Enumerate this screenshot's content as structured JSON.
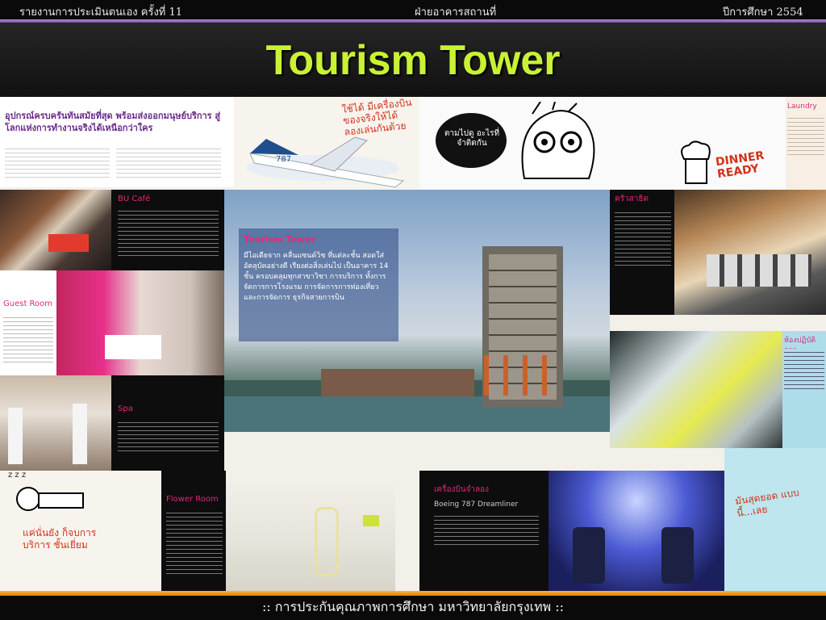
{
  "header": {
    "left_text": "รายงานการประเมินตนเอง ครั้งที่ 11",
    "center_text": "ฝ่ายอาคารสถานที่",
    "right_text": "ปีการศึกษา 2554"
  },
  "title": "Tourism Tower",
  "collage": {
    "intro_heading": "อุปกรณ์ครบครันทันสมัยที่สุด พร้อมส่งออกมนุษย์บริการ สู่โลกแห่งการทำงานจริงได้เหนือกว่าใคร",
    "handwriting_top": "ใช้ได้ มีเครื่องบิน ของจริงให้ได้ ลองเล่นกันด้วย",
    "bubble_text": "ตามไปดู อะไรที่จำติดกัน",
    "dinner_ready": "DINNER READY",
    "laundry_label": "Laundry",
    "bu_cafe_label": "BU Café",
    "tourism_tower_label": "Tourism Tower",
    "tourism_tower_desc": "มีไอเดียจาก คลื่นแซนด์วิช ที่แต่ละชั้น สอดใส่ อัตลุบัคอย่างดี เรียงต่อสิ่งเล่นไป เป็นอาคาร 14 ชั้น ครอบคลุมทุกสาขาวิชา การบริการ ทั้งการจัดการการโรงแรม การจัดการการท่องเที่ยว และการจัดการ ธุรกิจสายการบิน",
    "kitchen_label": "ครัวสาธิต",
    "guest_room_label": "Guest Room",
    "spa_label": "Spa",
    "practice_room_label": "ห้องปฏิบัติการ",
    "flower_room_label": "Flower Room",
    "airplane_label": "เครื่องบินจำลอง",
    "airplane_desc": "Boeing 787 Dreamliner",
    "handwriting_bottom_left": "แค่นั่นยัง ก็จบการบริการ ชั้นเยี่ยม",
    "handwriting_bottom_right": "มันสุดยอด แบบนี้...เลย",
    "zzz": "z z z"
  },
  "footer": {
    "text": ":: การประกันคุณภาพการศึกษา มหาวิทยาลัยกรุงเทพ ::"
  }
}
